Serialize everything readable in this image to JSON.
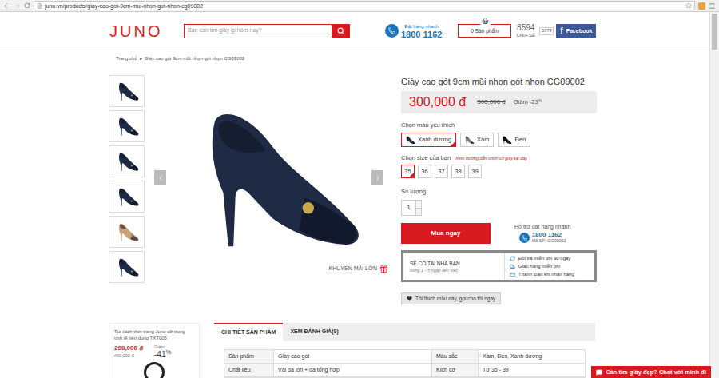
{
  "browser": {
    "url": "juno.vn/products/giay-cao-got-9cm-mui-nhon-got-nhon-cg09002"
  },
  "header": {
    "logo": "JUNO",
    "search_placeholder": "Bạn cần tìm giày gì hôm nay?",
    "hotline_label": "Đặt hàng nhanh",
    "hotline": "1800 1162",
    "cart": "0 Sản phẩm",
    "share_count": "8594",
    "share_label": "CHIA SẺ",
    "like_count": "5379",
    "facebook_icon": "f",
    "facebook": "Facebook"
  },
  "breadcrumb": {
    "items": [
      "Trang chủ",
      "Giày cao gót 9cm mũi nhọn gót nhọn CG09002"
    ],
    "separator": "▸"
  },
  "gallery": {
    "thumbnails": [
      {
        "color": "#1f2a44"
      },
      {
        "color": "#1f2a44"
      },
      {
        "color": "#1f2a44"
      },
      {
        "color": "#1f2a44"
      },
      {
        "color": "#c9a27e"
      },
      {
        "color": "#1f2a44"
      }
    ],
    "promo": "KHUYẾN MÃI LỚN"
  },
  "product": {
    "title": "Giày cao gót 9cm mũi nhọn gót nhọn CG09002",
    "price": "300,000 đ",
    "old_price": "300,000 đ",
    "discount": "Giảm -23",
    "discount_unit": "%",
    "colors_label": "Chọn màu yêu thích",
    "colors": [
      {
        "label": "Xanh dương",
        "selected": true,
        "color": "#1f2a44"
      },
      {
        "label": "Xám",
        "selected": false,
        "color": "#8a7f76"
      },
      {
        "label": "Đen",
        "selected": false,
        "color": "#111111"
      }
    ],
    "size_label": "Chọn size của bạn",
    "size_guide": "Xem hướng dẫn chọn cỡ giày tại đây",
    "sizes": [
      {
        "label": "35",
        "selected": true
      },
      {
        "label": "36",
        "selected": false
      },
      {
        "label": "37",
        "selected": false
      },
      {
        "label": "38",
        "selected": false
      },
      {
        "label": "39",
        "selected": false
      }
    ],
    "quantity_label": "Số lượng",
    "quantity": "1",
    "buy": "Mua ngay",
    "support": {
      "label": "Hỗ trợ đặt hàng nhanh",
      "phone": "1800 1162",
      "code": "Mã SP: CG09002"
    },
    "delivery": {
      "title": "SẼ CÓ TẠI NHÀ BẠN",
      "subtitle": "trong 1 - 5 ngày làm việc",
      "perks": [
        "Đổi trả miễn phí 90 ngày",
        "Giao hàng miễn phí",
        "Thanh toán khi nhận hàng"
      ]
    },
    "callback": "Tôi thích mẫu này, gọi cho tôi ngay"
  },
  "related": {
    "title": "Túi xách thời trang Juno cỡ trung tính tế tiện dụng TXT005",
    "price": "290,000 đ",
    "old_price": "490,000 đ",
    "discount_label": "Giảm",
    "discount": "-41",
    "discount_unit": "%"
  },
  "tabs": [
    {
      "label": "CHI TIẾT SẢN PHẨM",
      "selected": true
    },
    {
      "label": "XEM ĐÁNH GIÁ(9)",
      "selected": false
    }
  ],
  "details": {
    "rows": [
      [
        "Sản phẩm",
        "Giày cao gót",
        "Màu sắc",
        "Xám, Đen, Xanh dương"
      ],
      [
        "Chất liệu",
        "Vải da lộn + da tổng hợp",
        "Kích cỡ",
        "Từ 35 - 39"
      ]
    ]
  },
  "chat": "Cần tìm giày đẹp? Chat với mình đi"
}
